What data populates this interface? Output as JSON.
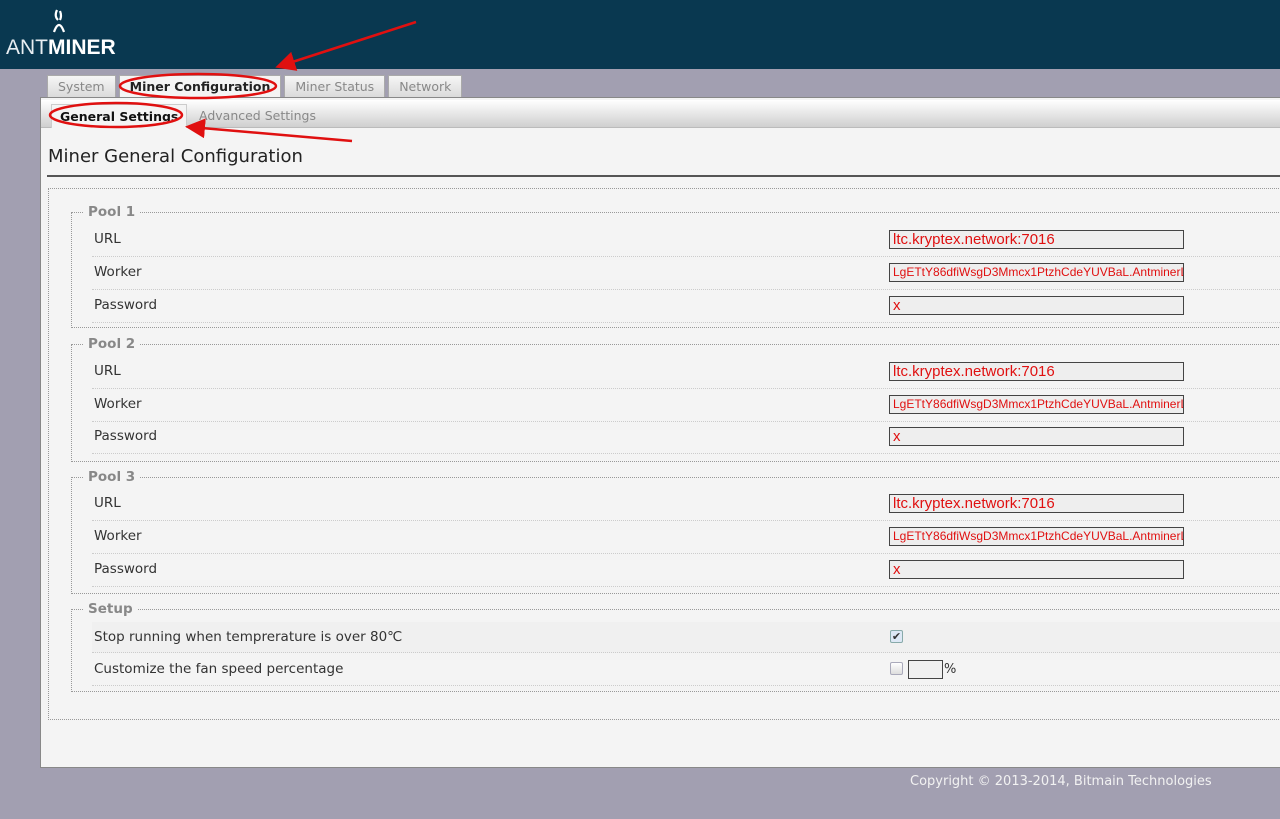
{
  "brand": {
    "logo_left": "ANT",
    "logo_right": "MINER"
  },
  "tabs": [
    {
      "label": "System"
    },
    {
      "label": "Miner Configuration"
    },
    {
      "label": "Miner Status"
    },
    {
      "label": "Network"
    }
  ],
  "subtabs": [
    {
      "label": "General Settings"
    },
    {
      "label": "Advanced Settings"
    }
  ],
  "page_title": "Miner General Configuration",
  "pools": [
    {
      "legend": "Pool 1",
      "url_label": "URL",
      "url": "ltc.kryptex.network:7016",
      "worker_label": "Worker",
      "worker": "LgETtY86dfiWsgD3Mmcx1PtzhCdeYUVBaL.AntminerL",
      "password_label": "Password",
      "password": "x"
    },
    {
      "legend": "Pool 2",
      "url_label": "URL",
      "url": "ltc.kryptex.network:7016",
      "worker_label": "Worker",
      "worker": "LgETtY86dfiWsgD3Mmcx1PtzhCdeYUVBaL.AntminerL",
      "password_label": "Password",
      "password": "x"
    },
    {
      "legend": "Pool 3",
      "url_label": "URL",
      "url": "ltc.kryptex.network:7016",
      "worker_label": "Worker",
      "worker": "LgETtY86dfiWsgD3Mmcx1PtzhCdeYUVBaL.AntminerL",
      "password_label": "Password",
      "password": "x"
    }
  ],
  "setup": {
    "legend": "Setup",
    "temp_label": "Stop running when temprerature is over 80℃",
    "temp_checked": true,
    "fan_label": "Customize the fan speed percentage",
    "fan_checked": false,
    "fan_value": "",
    "fan_unit": "%"
  },
  "footer": "Copyright © 2013-2014, Bitmain Technologies",
  "colors": {
    "header": "#093850",
    "annotation": "#e01010"
  }
}
